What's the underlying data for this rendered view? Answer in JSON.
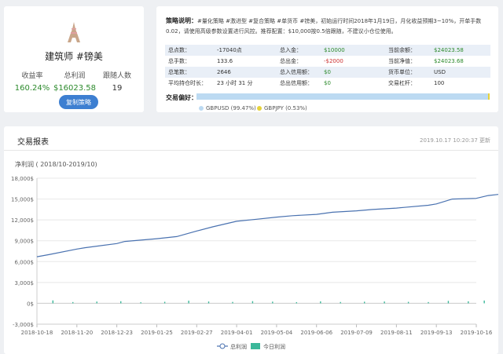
{
  "profile": {
    "avatar_icon": "eiffel-tower-icon",
    "name": "建筑师 #镑美",
    "stats": [
      {
        "label": "收益率",
        "value": "160.24%",
        "color": "#2c8a2c"
      },
      {
        "label": "总利润",
        "value": "$16023.58",
        "color": "#2c8a2c"
      },
      {
        "label": "跟随人数",
        "value": "19",
        "color": "#333333"
      }
    ],
    "copy_button": "复制策略"
  },
  "info": {
    "desc_title": "策略说明：",
    "desc_text": "#量化策略 #激进型 #复合策略 #单货币 #镑美，初始运行时间2018年1月19日，月化收益预期3~10%，开单手数0.02，请使用高级参数设置进行风控。推荐配置：$10,000按0.5倍跟随，不建议小仓位使用。",
    "rows": [
      [
        "总点数：",
        "-17040点",
        "总入金：",
        "$10000",
        "当前余额：",
        "$24023.58"
      ],
      [
        "总手数：",
        "133.6",
        "总出金：",
        "-$2000",
        "当前净值：",
        "$24023.68"
      ],
      [
        "总笔数：",
        "2646",
        "总入信用额：",
        "$0",
        "货币单位：",
        "USD"
      ],
      [
        "平均持仓时长：",
        "23 小时 31 分",
        "总出信用额：",
        "$0",
        "交易杠杆：",
        "100"
      ]
    ],
    "pref_label": "交易偏好：",
    "pref_items": [
      {
        "label": "GBPUSD (99.47%)",
        "color": "#bcdaf2"
      },
      {
        "label": "GBPJPY (0.53%)",
        "color": "#e6d23a"
      }
    ],
    "pref_share": [
      0.9947,
      0.0053
    ]
  },
  "report": {
    "title": "交易报表",
    "updated": "2019.10.17 10:20:37 更新",
    "subtitle": "净利润 ( 2018/10-2019/10)"
  },
  "chart_data": {
    "type": "line",
    "xlabels": [
      "2018-10-18",
      "2018-11-20",
      "2018-12-23",
      "2019-01-25",
      "2019-02-27",
      "2019-04-01",
      "2019-05-04",
      "2019-06-06",
      "2019-07-09",
      "2019-08-11",
      "2019-09-13",
      "2019-10-16"
    ],
    "yticks": [
      "-3,000$",
      "0$",
      "3,000$",
      "6,000$",
      "9,000$",
      "12,000$",
      "15,000$",
      "18,000$"
    ],
    "ylim": [
      -3000,
      18000
    ],
    "series": [
      {
        "name": "总利润",
        "type": "line",
        "color": "#4a72b0",
        "x": [
          0,
          0.3,
          1,
          1.2,
          2,
          2.2,
          3,
          3.5,
          4,
          4.4,
          5,
          5.5,
          6,
          6.4,
          7,
          7.4,
          8,
          8.4,
          9,
          9.2,
          9.8,
          10,
          10.4,
          11,
          11.3,
          11.6,
          12
        ],
        "values": [
          6700,
          7000,
          7800,
          8000,
          8600,
          8900,
          9300,
          9600,
          10400,
          11000,
          11800,
          12100,
          12400,
          12600,
          12800,
          13100,
          13300,
          13500,
          13700,
          13800,
          14100,
          14300,
          15000,
          15100,
          15500,
          15700,
          16023.58
        ]
      },
      {
        "name": "今日利润",
        "type": "bar",
        "color": "#3cb89a",
        "x": [
          0.4,
          0.9,
          1.5,
          2.1,
          2.6,
          3.2,
          3.8,
          4.3,
          4.9,
          5.4,
          5.9,
          6.5,
          7.1,
          7.6,
          8.2,
          8.7,
          9.3,
          9.8,
          10.3,
          10.8,
          11.2,
          11.6
        ],
        "values": [
          420,
          180,
          250,
          300,
          150,
          220,
          380,
          260,
          200,
          310,
          240,
          170,
          280,
          190,
          230,
          260,
          210,
          180,
          350,
          290,
          400,
          230
        ]
      }
    ]
  }
}
